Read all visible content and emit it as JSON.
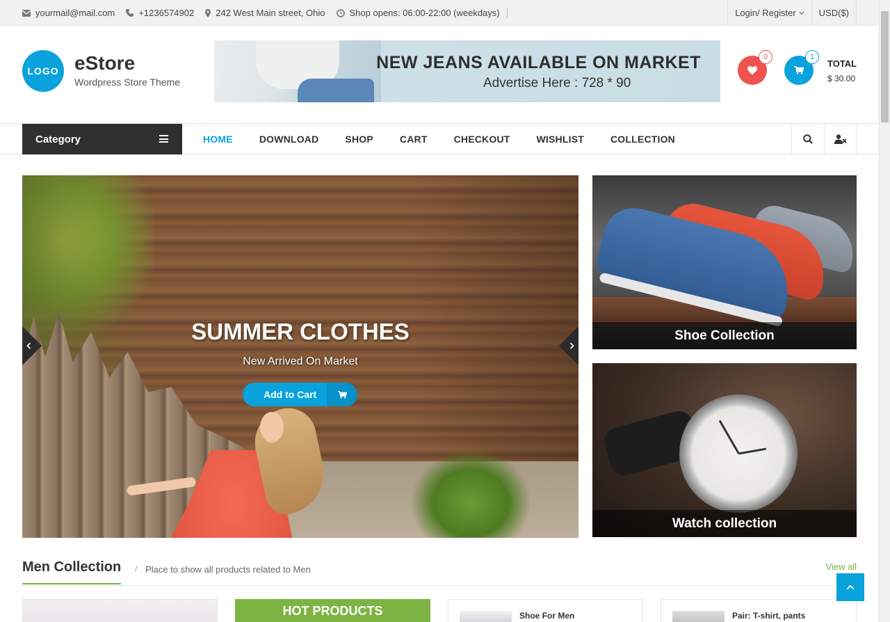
{
  "topbar": {
    "email": "yourmail@mail.com",
    "phone": "+1236574902",
    "address": "242 West Main street, Ohio",
    "hours": "Shop opens: 06:00-22:00 (weekdays)",
    "login": "Login/ Register",
    "currency": "USD($)"
  },
  "header": {
    "logo": "LOGO",
    "site_name": "eStore",
    "tagline": "Wordpress Store Theme",
    "ad_title": "NEW JEANS AVAILABLE ON MARKET",
    "ad_sub": "Advertise Here : 728 * 90",
    "wishlist_count": "0",
    "cart_count": "1",
    "total_label": "TOTAL",
    "total_amount": "$ 30.00"
  },
  "nav": {
    "category": "Category",
    "items": [
      {
        "label": "HOME",
        "active": true
      },
      {
        "label": "DOWNLOAD"
      },
      {
        "label": "SHOP"
      },
      {
        "label": "CART"
      },
      {
        "label": "CHECKOUT"
      },
      {
        "label": "WISHLIST"
      },
      {
        "label": "COLLECTION"
      }
    ]
  },
  "slider": {
    "heading": "SUMMER CLOTHES",
    "subheading": "New Arrived On Market",
    "button": "Add to Cart"
  },
  "promos": {
    "shoe": "Shoe Collection",
    "watch": "Watch collection"
  },
  "section": {
    "title": "Men Collection",
    "slash": "/",
    "desc": "Place to show all products related to Men",
    "view_all": "View all"
  },
  "cards": {
    "hot": "HOT PRODUCTS",
    "p1": "Shoe For Men",
    "p2": "Pair: T-shirt, pants"
  },
  "colors": {
    "accent": "#0aa2dc",
    "green": "#7cb342",
    "wishlist": "#ef5350",
    "dark": "#2f2f2f"
  }
}
